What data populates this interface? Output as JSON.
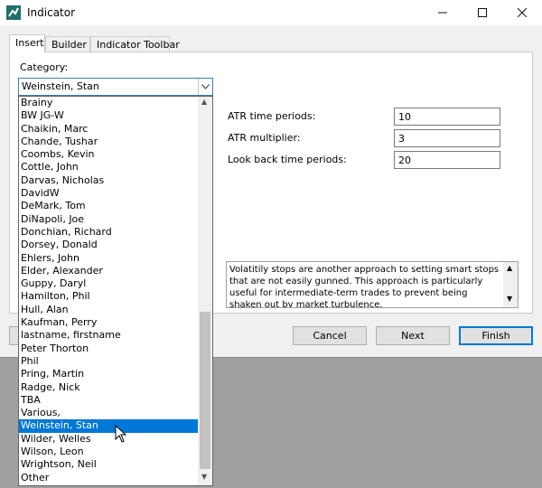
{
  "window": {
    "title": "Indicator"
  },
  "tabs": [
    "Insert",
    "Builder",
    "Indicator Toolbar"
  ],
  "category": {
    "label": "Category:",
    "selected": "Weinstein, Stan",
    "items": [
      "Brainy",
      "BW JG-W",
      "Chaikin, Marc",
      "Chande, Tushar",
      "Coombs, Kevin",
      "Cottle, John",
      "Darvas, Nicholas",
      "DavidW",
      "DeMark, Tom",
      "DiNapoli, Joe",
      "Donchian, Richard",
      "Dorsey, Donald",
      "Ehlers, John",
      "Elder, Alexander",
      "Guppy, Daryl",
      "Hamilton, Phil",
      "Hull, Alan",
      "Kaufman, Perry",
      "lastname, firstname",
      "Peter Thorton",
      "Phil",
      "Pring, Martin",
      "Radge, Nick",
      "TBA",
      "Various,",
      "Weinstein, Stan",
      "Wilder, Welles",
      "Wilson, Leon",
      "Wrightson, Neil",
      "Other"
    ]
  },
  "params": [
    {
      "label": "ATR time periods:",
      "value": "10"
    },
    {
      "label": "ATR multiplier:",
      "value": "3"
    },
    {
      "label": "Look back time periods:",
      "value": "20"
    }
  ],
  "description": "Volatitily stops are another approach to setting smart stops that are not easily gunned.  This approach is particularly useful for intermediate-term trades to prevent being shaken out by market turbulence.",
  "buttons": {
    "cancel": "Cancel",
    "next": "Next",
    "finish": "Finish"
  },
  "colors": {
    "accent": "#0078d7",
    "selection": "#0078d7"
  }
}
